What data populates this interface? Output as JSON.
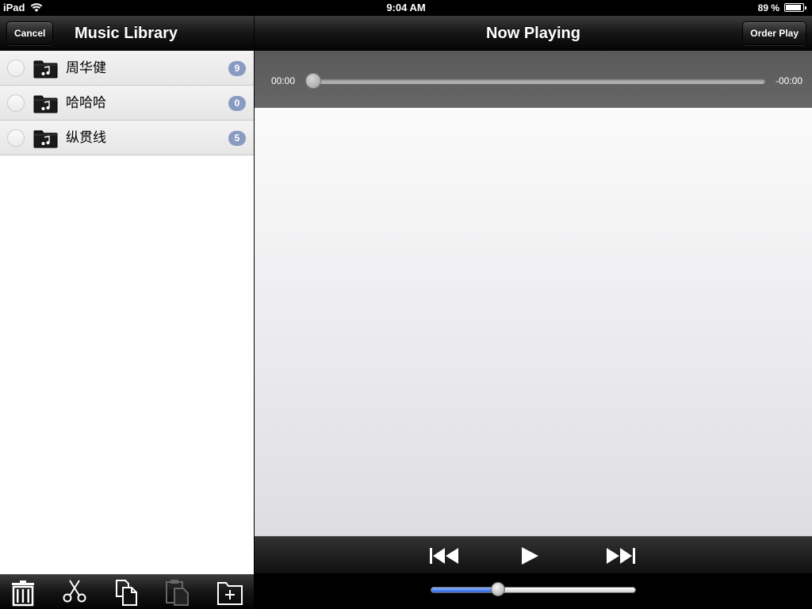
{
  "status_bar": {
    "device": "iPad",
    "time": "9:04 AM",
    "battery": "89 %"
  },
  "left_nav": {
    "cancel_label": "Cancel",
    "title": "Music Library"
  },
  "right_nav": {
    "title": "Now Playing",
    "order_play_label": "Order Play"
  },
  "library": {
    "items": [
      {
        "label": "周华健",
        "count": "9"
      },
      {
        "label": "哈哈哈",
        "count": "0"
      },
      {
        "label": "纵贯线",
        "count": "5"
      }
    ]
  },
  "toolbar": {
    "icons": [
      "trash-icon",
      "cut-icon",
      "copy-icon",
      "paste-icon",
      "new-folder-icon"
    ]
  },
  "player": {
    "elapsed": "00:00",
    "remaining": "-00:00",
    "progress": 0,
    "volume": 0.33
  },
  "colors": {
    "badge": "#8a9bc2",
    "volume_fill": "#2a66d8"
  }
}
